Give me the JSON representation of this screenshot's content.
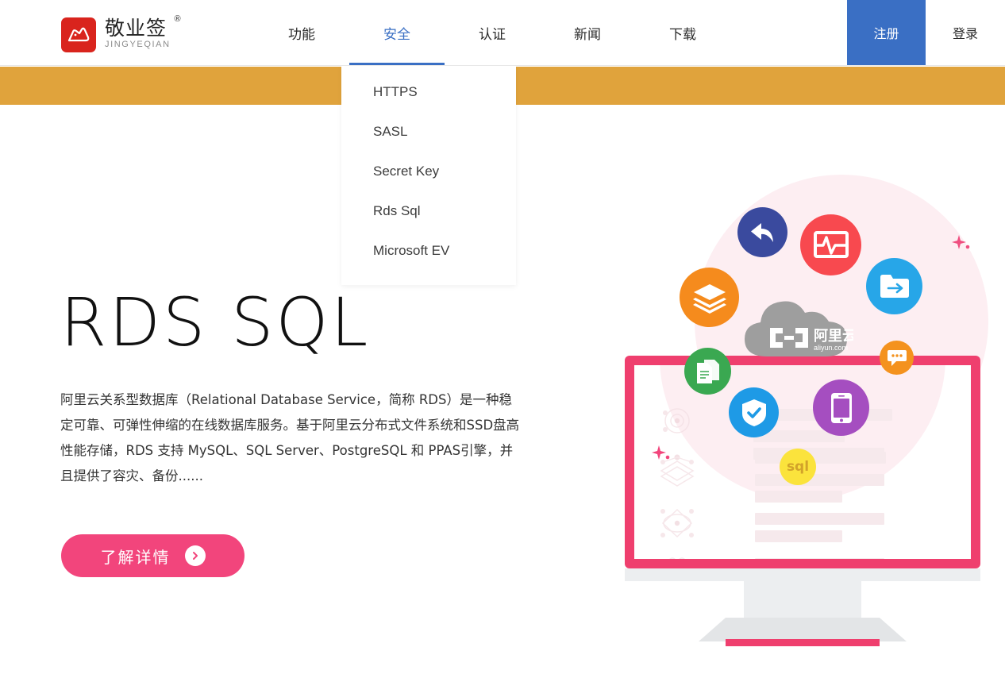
{
  "brand": {
    "name_cn": "敬业签",
    "name_en": "JINGYEQIAN",
    "registered_mark": "®",
    "logo_color": "#d9241d",
    "logo_icon": "cloud-hat-mark-icon"
  },
  "header": {
    "nav": [
      {
        "label": "功能",
        "active": false
      },
      {
        "label": "安全",
        "active": true
      },
      {
        "label": "认证",
        "active": false
      },
      {
        "label": "新闻",
        "active": false
      },
      {
        "label": "下载",
        "active": false
      }
    ],
    "register_label": "注册",
    "login_label": "登录",
    "accent_color": "#3a6fc4"
  },
  "dropdown": {
    "parent": "安全",
    "items": [
      {
        "label": "HTTPS"
      },
      {
        "label": "SASL"
      },
      {
        "label": "Secret Key"
      },
      {
        "label": "Rds Sql"
      },
      {
        "label": "Microsoft EV"
      }
    ]
  },
  "banner": {
    "color": "#e0a33c"
  },
  "hero": {
    "title": "RDS SQL",
    "description": "阿里云关系型数据库（Relational Database Service，简称 RDS）是一种稳定可靠、可弹性伸缩的在线数据库服务。基于阿里云分布式文件系统和SSD盘高性能存储，RDS 支持 MySQL、SQL Server、PostgreSQL 和 PPAS引擎，并且提供了容灾、备份......",
    "cta_label": "了解详情",
    "cta_color": "#f2457c",
    "cta_icon": "chevron-right-circle-icon"
  },
  "illustration": {
    "backdrop_color": "#fdeef2",
    "monitor_frame_color": "#ef3f6e",
    "cloud_logo": {
      "text_cn": "阿里云",
      "text_en": "aliyun.com",
      "color": "#9e9e9e",
      "icon": "aliyun-cloud-logo-icon"
    },
    "icons": [
      {
        "name": "reply-arrow-icon",
        "color": "#3a4a9e"
      },
      {
        "name": "monitor-pulse-icon",
        "color": "#f8494f"
      },
      {
        "name": "layers-stack-icon",
        "color": "#f58b1d"
      },
      {
        "name": "folder-export-icon",
        "color": "#27a6e8"
      },
      {
        "name": "documents-copy-icon",
        "color": "#3aa851"
      },
      {
        "name": "shield-check-icon",
        "color": "#1e9ae6"
      },
      {
        "name": "mobile-phone-icon",
        "color": "#a54ec0"
      },
      {
        "name": "chat-bubble-icon",
        "color": "#f4921e"
      },
      {
        "name": "sql-badge-icon",
        "color": "#fbe33c",
        "label": "sql"
      }
    ],
    "sparkle_color": "#f2457c"
  }
}
